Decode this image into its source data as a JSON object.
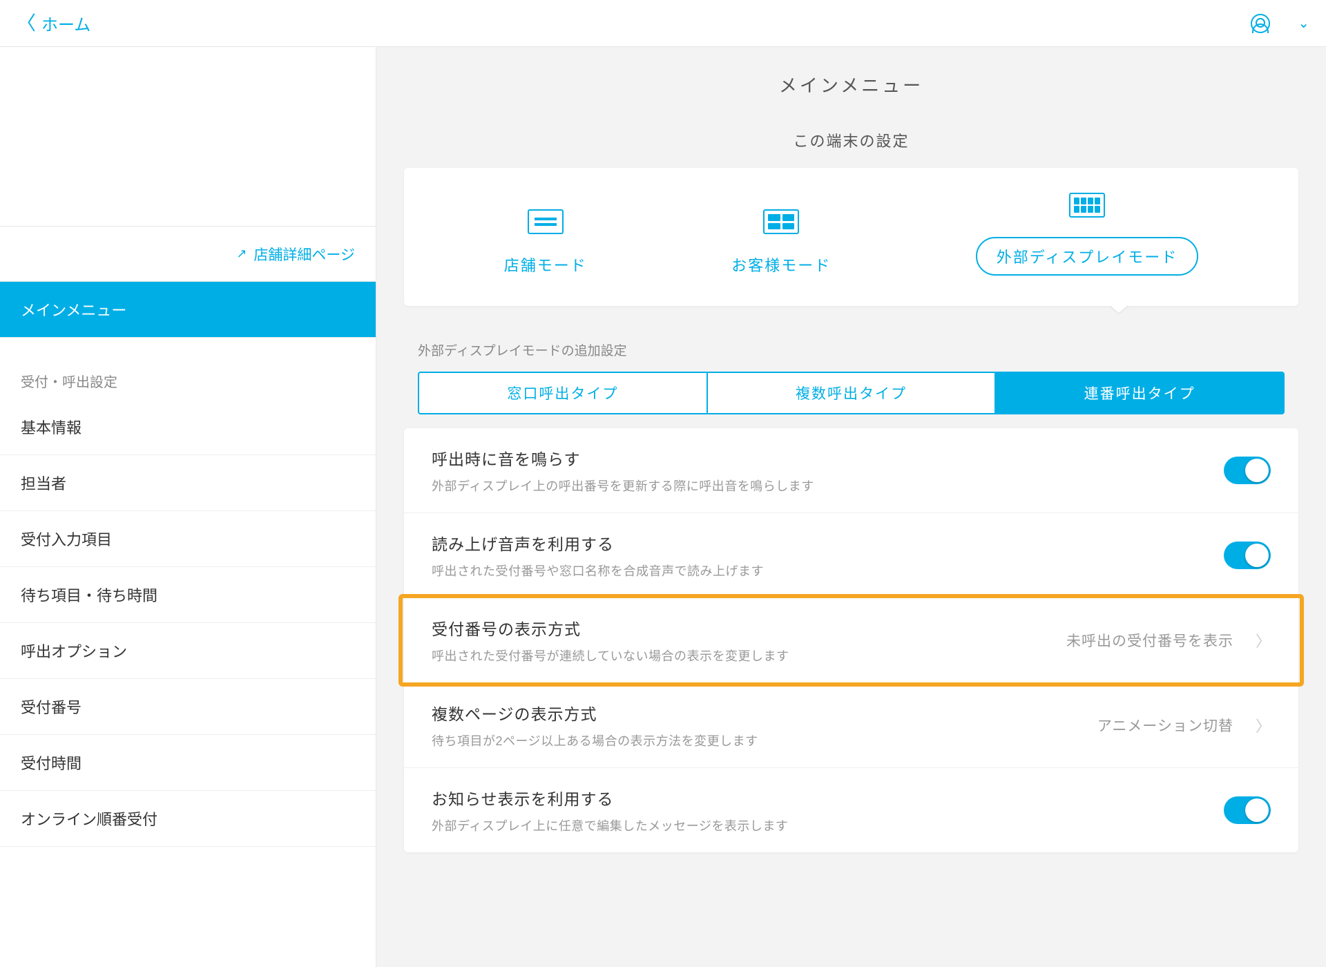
{
  "topbar": {
    "back_label": "ホーム"
  },
  "sidebar": {
    "store_detail_link": "店舗詳細ページ",
    "main_menu_label": "メインメニュー",
    "section_label": "受付・呼出設定",
    "items": [
      {
        "label": "基本情報"
      },
      {
        "label": "担当者"
      },
      {
        "label": "受付入力項目"
      },
      {
        "label": "待ち項目・待ち時間"
      },
      {
        "label": "呼出オプション"
      },
      {
        "label": "受付番号"
      },
      {
        "label": "受付時間"
      },
      {
        "label": "オンライン順番受付"
      }
    ]
  },
  "main": {
    "title": "メインメニュー",
    "device_settings_label": "この端末の設定",
    "modes": {
      "store": "店舗モード",
      "customer": "お客様モード",
      "display": "外部ディスプレイモード"
    },
    "subsection_label": "外部ディスプレイモードの追加設定",
    "segments": [
      {
        "label": "窓口呼出タイプ"
      },
      {
        "label": "複数呼出タイプ"
      },
      {
        "label": "連番呼出タイプ"
      }
    ],
    "settings": [
      {
        "title": "呼出時に音を鳴らす",
        "desc": "外部ディスプレイ上の呼出番号を更新する際に呼出音を鳴らします",
        "type": "toggle",
        "on": true
      },
      {
        "title": "読み上げ音声を利用する",
        "desc": "呼出された受付番号や窓口名称を合成音声で読み上げます",
        "type": "toggle",
        "on": true
      },
      {
        "title": "受付番号の表示方式",
        "desc": "呼出された受付番号が連続していない場合の表示を変更します",
        "type": "link",
        "value": "未呼出の受付番号を表示",
        "highlighted": true
      },
      {
        "title": "複数ページの表示方式",
        "desc": "待ち項目が2ページ以上ある場合の表示方法を変更します",
        "type": "link",
        "value": "アニメーション切替"
      },
      {
        "title": "お知らせ表示を利用する",
        "desc": "外部ディスプレイ上に任意で編集したメッセージを表示します",
        "type": "toggle",
        "on": true
      }
    ]
  }
}
